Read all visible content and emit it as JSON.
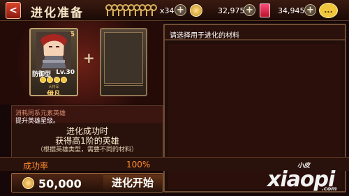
{
  "header": {
    "back_label": "<",
    "title": "进化准备",
    "resources": [
      {
        "name": "key",
        "count": "x34",
        "icon": "key-icon"
      },
      {
        "name": "gold",
        "count": "32,975",
        "icon": "gold-coin-icon"
      },
      {
        "name": "gem",
        "count": "34,945",
        "icon": "gem-icon"
      }
    ],
    "chat_label": "..."
  },
  "hero_card": {
    "plus_level": "+5",
    "type_label": "防御型",
    "level": "Lv.30",
    "stars": 4,
    "job": "大将军",
    "name": "伊凡"
  },
  "material_panel": {
    "title": "请选择用于进化的材料"
  },
  "info_panel": {
    "title": "消耗同系元素英雄",
    "desc": "提升英雄星级。",
    "main_1": "进化成功时",
    "main_2": "获得高1阶的英雄",
    "sub": "（根据英雄类型，需要不同的材料）",
    "rate_label": "成功率",
    "rate_value": "100%"
  },
  "action": {
    "cost": "50,000",
    "button_label": "进化开始"
  },
  "watermark": {
    "top": "小皮",
    "main": "xiaopi",
    "suffix": ".com"
  }
}
